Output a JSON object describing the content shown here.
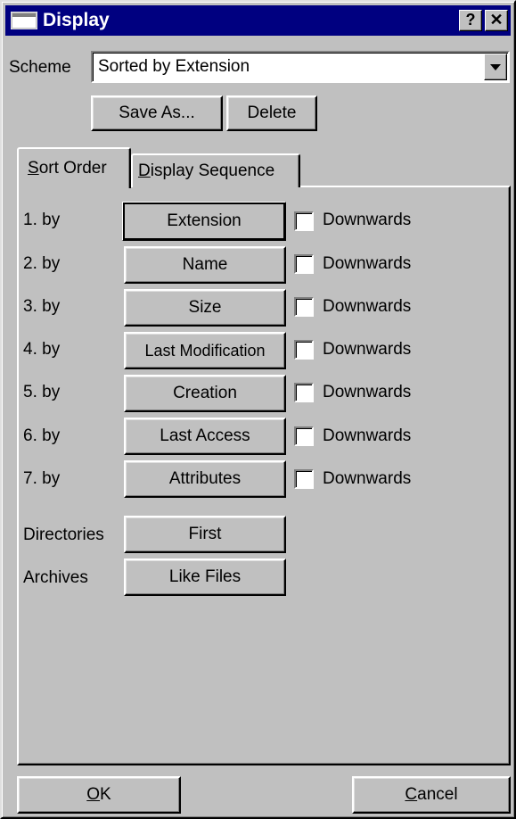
{
  "window": {
    "title": "Display"
  },
  "titlebar_buttons": {
    "help": "?",
    "close": "✕"
  },
  "scheme": {
    "label": "Scheme",
    "value": "Sorted by Extension"
  },
  "buttons": {
    "save_as": "Save As...",
    "delete": "Delete"
  },
  "tabs": [
    {
      "mnemonic": "S",
      "rest": "ort Order",
      "active": true
    },
    {
      "mnemonic": "D",
      "rest": "isplay Sequence",
      "active": false
    }
  ],
  "sort_rows": [
    {
      "order": "1. by",
      "field": "Extension",
      "downwards_label": "Downwards",
      "downwards_checked": false,
      "focused": true
    },
    {
      "order": "2. by",
      "field": "Name",
      "downwards_label": "Downwards",
      "downwards_checked": false
    },
    {
      "order": "3. by",
      "field": "Size",
      "downwards_label": "Downwards",
      "downwards_checked": false
    },
    {
      "order": "4. by",
      "field": "Last Modification",
      "downwards_label": "Downwards",
      "downwards_checked": false
    },
    {
      "order": "5. by",
      "field": "Creation",
      "downwards_label": "Downwards",
      "downwards_checked": false
    },
    {
      "order": "6. by",
      "field": "Last Access",
      "downwards_label": "Downwards",
      "downwards_checked": false
    },
    {
      "order": "7. by",
      "field": "Attributes",
      "downwards_label": "Downwards",
      "downwards_checked": false
    }
  ],
  "directories": {
    "label": "Directories",
    "value": "First"
  },
  "archives": {
    "label": "Archives",
    "value": "Like Files"
  },
  "footer": {
    "ok": {
      "mnemonic": "O",
      "rest": "K"
    },
    "cancel": {
      "mnemonic": "C",
      "rest": "ancel"
    }
  },
  "icons": {
    "window": "window-icon",
    "combo_arrow": "chevron-down-icon"
  }
}
